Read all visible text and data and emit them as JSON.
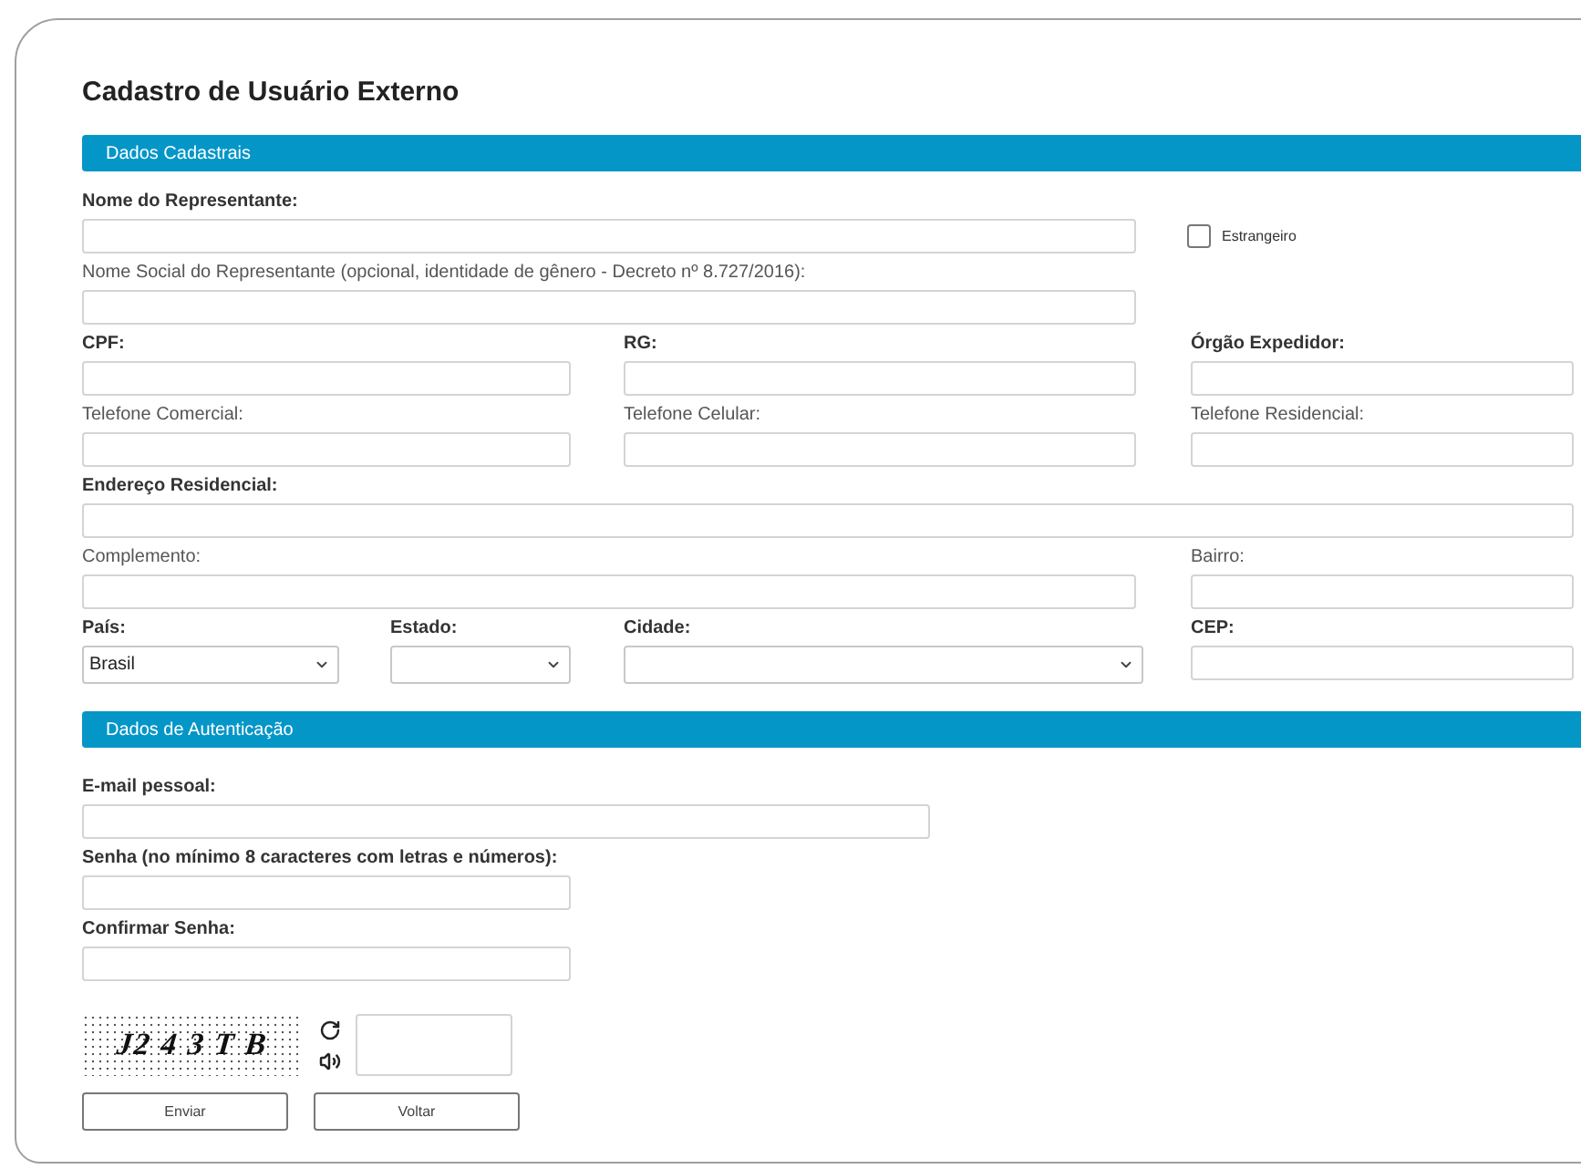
{
  "page_title": "Cadastro de Usuário Externo",
  "sections": [
    {
      "title": "Dados Cadastrais",
      "fields": [
        {
          "kind": "text",
          "label": "Nome do Representante:",
          "required": true
        },
        {
          "kind": "checkbox",
          "label": "Estrangeiro",
          "checked": false
        },
        {
          "kind": "text",
          "label": "Nome Social do Representante (opcional, identidade de gênero - Decreto nº 8.727/2016):",
          "required": false
        },
        {
          "kind": "text",
          "label": "CPF:",
          "required": true
        },
        {
          "kind": "text",
          "label": "RG:",
          "required": true
        },
        {
          "kind": "text",
          "label": "Órgão Expedidor:",
          "required": true
        },
        {
          "kind": "text",
          "label": "Telefone Comercial:",
          "required": false
        },
        {
          "kind": "text",
          "label": "Telefone Celular:",
          "required": false
        },
        {
          "kind": "text",
          "label": "Telefone Residencial:",
          "required": false
        },
        {
          "kind": "text",
          "label": "Endereço Residencial:",
          "required": true
        },
        {
          "kind": "text",
          "label": "Complemento:",
          "required": false
        },
        {
          "kind": "text",
          "label": "Bairro:",
          "required": false
        },
        {
          "kind": "select",
          "label": "País:",
          "required": true,
          "value": "Brasil"
        },
        {
          "kind": "select",
          "label": "Estado:",
          "required": true
        },
        {
          "kind": "select",
          "label": "Cidade:",
          "required": true
        },
        {
          "kind": "text",
          "label": "CEP:",
          "required": true
        }
      ]
    },
    {
      "title": "Dados de Autenticação",
      "fields": [
        {
          "kind": "text",
          "label": "E-mail pessoal:",
          "required": true
        },
        {
          "kind": "text",
          "label": "Senha (no mínimo 8 caracteres com letras e números):",
          "required": true
        },
        {
          "kind": "text",
          "label": "Confirmar Senha:",
          "required": true
        }
      ]
    }
  ],
  "captcha": {
    "text": "J2 4 3 T B"
  },
  "buttons": [
    "Enviar",
    "Voltar"
  ]
}
